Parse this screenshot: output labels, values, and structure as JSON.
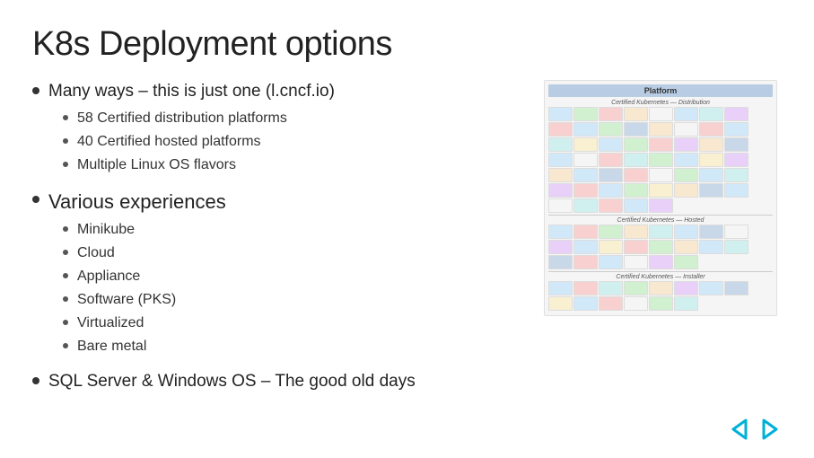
{
  "slide": {
    "title": "K8s Deployment options",
    "bullets": [
      {
        "id": "bullet-1",
        "text": "Many ways – this is just one (l.cncf.io)",
        "large": false,
        "subbullets": [
          "58 Certified distribution platforms",
          "40 Certified hosted platforms",
          "Multiple Linux OS flavors"
        ]
      },
      {
        "id": "bullet-2",
        "text": "Various experiences",
        "large": true,
        "subbullets": [
          "Minikube",
          "Cloud",
          "Appliance",
          "Software (PKS)",
          "Virtualized",
          "Bare metal"
        ]
      },
      {
        "id": "bullet-3",
        "text": "SQL Server & Windows OS – The good old days",
        "large": false,
        "subbullets": []
      }
    ]
  },
  "chart": {
    "title": "Platform",
    "section1_label": "Certified Kubernetes — Distribution",
    "section2_label": "Certified Kubernetes — Hosted",
    "section3_label": "Certified Kubernetes — Installer"
  },
  "nav": {
    "back_label": "❮",
    "forward_label": "❯"
  }
}
